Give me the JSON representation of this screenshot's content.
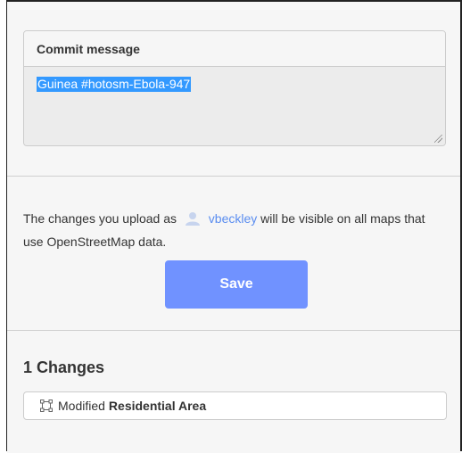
{
  "commit": {
    "label": "Commit message",
    "value": "Guinea #hotosm-Ebola-947"
  },
  "upload": {
    "text_before": "The changes you upload as",
    "username": "vbeckley",
    "text_after": "will be visible on all maps that use OpenStreetMap data.",
    "save_label": "Save",
    "accent_color": "#7092ff",
    "link_color": "#5a8df0"
  },
  "changes": {
    "title": "1 Changes",
    "items": [
      {
        "icon": "area-icon",
        "action": "Modified",
        "target": "Residential Area"
      }
    ]
  }
}
